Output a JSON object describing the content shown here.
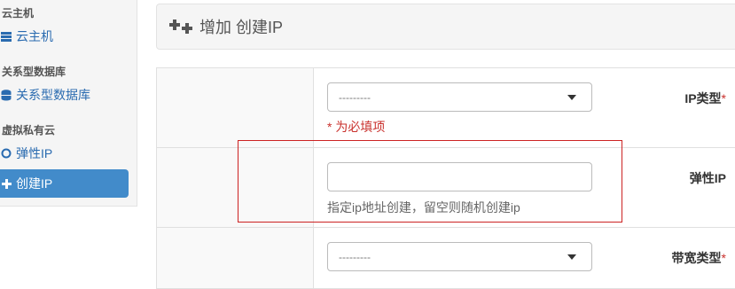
{
  "sidebar": {
    "sections": [
      {
        "title": "云主机",
        "items": [
          {
            "label": "云主机",
            "icon": "server-icon",
            "active": false
          }
        ]
      },
      {
        "title": "关系型数据库",
        "items": [
          {
            "label": "关系型数据库",
            "icon": "database-icon",
            "active": false
          }
        ]
      },
      {
        "title": "虚拟私有云",
        "items": [
          {
            "label": "弹性IP",
            "icon": "circle-icon",
            "active": false
          },
          {
            "label": "创建IP",
            "icon": "plus-icon",
            "active": true
          }
        ]
      }
    ]
  },
  "header": {
    "title": "增加 创建IP",
    "icon": "add-icon"
  },
  "form": {
    "ip_type": {
      "label": "IP类型",
      "required_mark": "*",
      "selected": "---------",
      "error": "* 为必填项"
    },
    "elastic_ip": {
      "label": "弹性IP",
      "value": "",
      "help": "指定ip地址创建，留空则随机创建ip"
    },
    "bandwidth_type": {
      "label": "带宽类型",
      "required_mark": "*",
      "selected": "---------"
    }
  },
  "colors": {
    "accent": "#428bca",
    "error": "#c9302c",
    "highlight": "#cc2222"
  }
}
